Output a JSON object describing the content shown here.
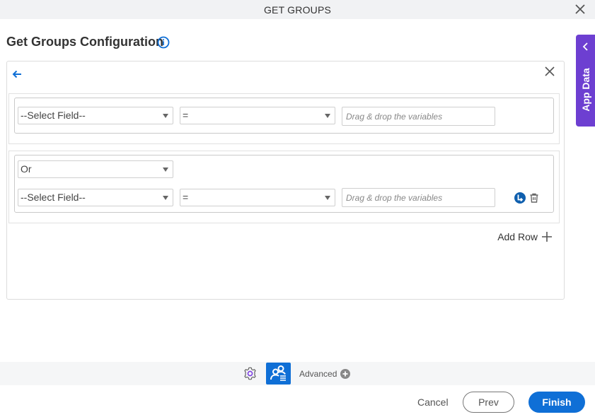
{
  "window": {
    "title": "GET GROUPS"
  },
  "page": {
    "heading": "Get Groups Configuration"
  },
  "conditions": {
    "rows": [
      {
        "field": "--Select Field--",
        "operator": "=",
        "value_placeholder": "Drag & drop the variables"
      },
      {
        "logic": "Or",
        "field": "--Select Field--",
        "operator": "=",
        "value_placeholder": "Drag & drop the variables"
      }
    ],
    "add_row_label": "Add Row"
  },
  "side_panel": {
    "label": "App Data"
  },
  "toolbar": {
    "advanced_label": "Advanced"
  },
  "footer": {
    "cancel_label": "Cancel",
    "prev_label": "Prev",
    "finish_label": "Finish"
  },
  "colors": {
    "accent": "#0f6fd6",
    "app_data": "#6d3fd1"
  }
}
